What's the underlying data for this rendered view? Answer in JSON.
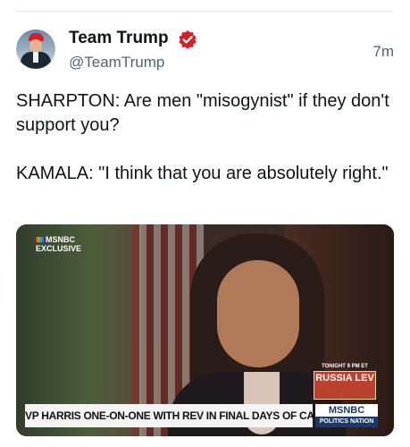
{
  "tweet": {
    "author_name": "Team Trump",
    "handle": "@TeamTrump",
    "time": "7m",
    "text_paragraph_1": "SHARPTON: Are men \"misogynist\" if they don't support you?",
    "text_paragraph_2": "KAMALA: \"I think that you are absolutely right.\""
  },
  "media": {
    "corner_logo_line1": "MSNBC",
    "corner_logo_line2": "EXCLUSIVE",
    "promo_time": "TONIGHT 9 PM ET",
    "promo_title": "RUSSIA LEV",
    "lower_third": "VP HARRIS ONE-ON-ONE WITH REV IN FINAL DAYS OF CAMPAIGN",
    "network_name": "MSNBC",
    "network_show": "POLITICS NATION"
  },
  "colors": {
    "verified_badge": "#d61f26",
    "secondary_text": "#536471"
  }
}
